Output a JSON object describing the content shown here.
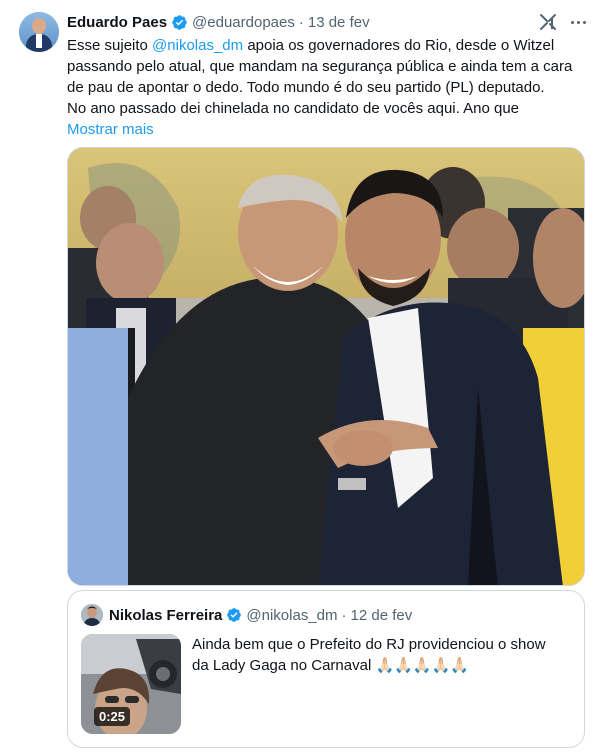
{
  "tweet": {
    "author_name": "Eduardo Paes",
    "author_handle": "@eduardopaes",
    "separator": "·",
    "date": "13 de fev",
    "text_lines": [
      {
        "pre": "Esse sujeito ",
        "mention": "@nikolas_dm",
        "post": " apoia os governadores do Rio, desde o Witzel"
      },
      {
        "pre": "passando pelo atual, que mandam na segurança pública e ainda tem a cara"
      },
      {
        "pre": "de pau de apontar o dedo.  Todo mundo é do seu partido (PL) deputado."
      },
      {
        "pre": "No ano passado dei chinelada no candidato de vocês aqui.  Ano que"
      }
    ],
    "show_more": "Mostrar mais",
    "icons": {
      "verified": "verified-badge-icon",
      "grok": "grok-icon",
      "more": "more-options-icon"
    },
    "colors": {
      "accent": "#1d9bf0",
      "text": "#0f1419",
      "secondary": "#536471",
      "border": "#cfd9de"
    }
  },
  "quote": {
    "author_name": "Nikolas Ferreira",
    "author_handle": "@nikolas_dm",
    "separator": "·",
    "date": "12 de fev",
    "text_lines": [
      "Ainda bem que o Prefeito do RJ providenciou o show",
      "da Lady Gaga no Carnaval 🙏🏻🙏🏻🙏🏻🙏🏻🙏🏻"
    ],
    "video_duration": "0:25"
  }
}
